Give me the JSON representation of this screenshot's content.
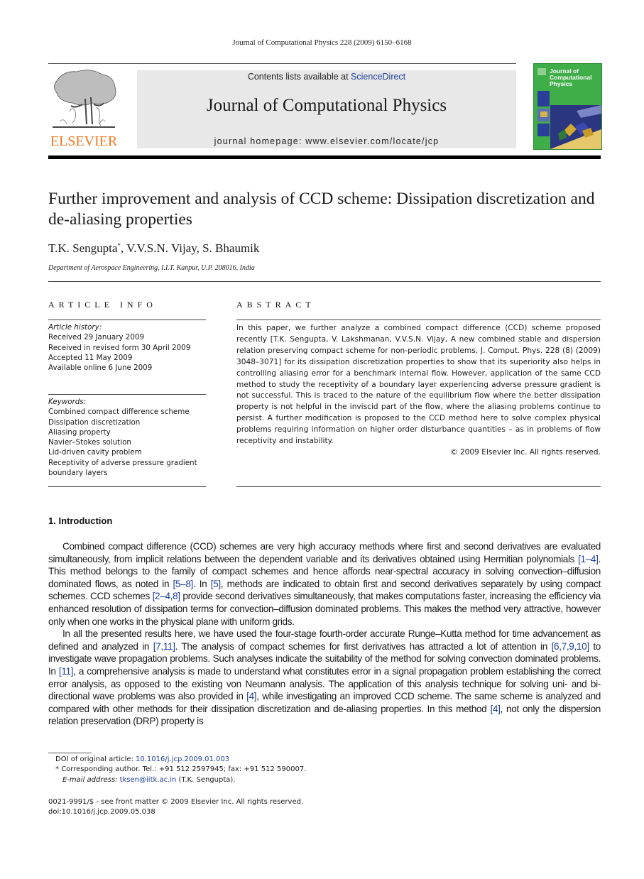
{
  "header": {
    "running_head": "Journal of Computational Physics 228 (2009) 6150–6168",
    "contents_prefix": "Contents lists available at ",
    "contents_link": "ScienceDirect",
    "journal_title": "Journal of Computational Physics",
    "homepage": "journal homepage: www.elsevier.com/locate/jcp",
    "publisher_logo_text": "ELSEVIER",
    "cover_title": [
      "Journal of",
      "Computational",
      "Physics"
    ],
    "colors": {
      "publisher_orange": "#f07a1e",
      "link_blue": "#1f3f9a",
      "cover_green": "#3fae49",
      "banner_gray": "#e8e8e8"
    }
  },
  "article": {
    "title": "Further improvement and analysis of CCD scheme: Dissipation discretization and de-aliasing properties",
    "authors": [
      {
        "name": "T.K. Sengupta",
        "mark": "*"
      },
      {
        "name": ", V.V.S.N. Vijay, S. Bhaumik",
        "mark": ""
      }
    ],
    "affiliation": "Department of Aerospace Engineering, I.I.T. Kanpur, U.P. 208016, India"
  },
  "article_info": {
    "heading": "ARTICLE INFO",
    "history_label": "Article history:",
    "history": [
      "Received 29 January 2009",
      "Received in revised form 30 April 2009",
      "Accepted 11 May 2009",
      "Available online 6 June 2009"
    ],
    "keywords_label": "Keywords:",
    "keywords": [
      "Combined compact difference scheme",
      "Dissipation discretization",
      "Aliasing property",
      "Navier–Stokes solution",
      "Lid-driven cavity problem",
      "Receptivity of adverse pressure gradient",
      "boundary layers"
    ]
  },
  "abstract": {
    "heading": "ABSTRACT",
    "text": "In this paper, we further analyze a combined compact difference (CCD) scheme proposed recently [T.K. Sengupta, V. Lakshmanan, V.V.S.N. Vijay, A new combined stable and dispersion relation preserving compact scheme for non-periodic problems, J. Comput. Phys. 228 (8) (2009) 3048–3071] for its dissipation discretization properties to show that its superiority also helps in controlling aliasing error for a benchmark internal flow. However, application of the same CCD method to study the receptivity of a boundary layer experiencing adverse pressure gradient is not successful. This is traced to the nature of the equilibrium flow where the better dissipation property is not helpful in the inviscid part of the flow, where the aliasing problems continue to persist. A further modification is proposed to the CCD method here to solve complex physical problems requiring information on higher order disturbance quantities – as in problems of flow receptivity and instability.",
    "copyright": "© 2009 Elsevier Inc. All rights reserved."
  },
  "introduction": {
    "heading": "1. Introduction",
    "paragraphs": [
      [
        {
          "t": "Combined compact difference (CCD) schemes are very high accuracy methods where first and second derivatives are evaluated simultaneously, from implicit relations between the dependent variable and its derivatives obtained using Hermitian polynomials "
        },
        {
          "c": "[1–4]"
        },
        {
          "t": ". This method belongs to the family of compact schemes and hence affords near-spectral accuracy in solving convection–diffusion dominated flows, as noted in "
        },
        {
          "c": "[5–8]"
        },
        {
          "t": ". In "
        },
        {
          "c": "[5]"
        },
        {
          "t": ", methods are indicated to obtain first and second derivatives separately by using compact schemes. CCD schemes "
        },
        {
          "c": "[2–4,8]"
        },
        {
          "t": " provide second derivatives simultaneously, that makes computations faster, increasing the efficiency via enhanced resolution of dissipation terms for convection–diffusion dominated problems. This makes the method very attractive, however only when one works in the physical plane with uniform grids."
        }
      ],
      [
        {
          "t": "In all the presented results here, we have used the four-stage fourth-order accurate Runge–Kutta method for time advancement as defined and analyzed in "
        },
        {
          "c": "[7,11]"
        },
        {
          "t": ". The analysis of compact schemes for first derivatives has attracted a lot of attention in "
        },
        {
          "c": "[6,7,9,10]"
        },
        {
          "t": " to investigate wave propagation problems. Such analyses indicate the suitability of the method for solving convection dominated problems. In "
        },
        {
          "c": "[11]"
        },
        {
          "t": ", a comprehensive analysis is made to understand what constitutes error in a signal propagation problem establishing the correct error analysis, as opposed to the existing von Neumann analysis. The application of this analysis technique for solving uni- and bi-directional wave problems was also provided in "
        },
        {
          "c": "[4]"
        },
        {
          "t": ", while investigating an improved CCD scheme. The same scheme is analyzed and compared with other methods for their dissipation discretization and de-aliasing properties. In this method "
        },
        {
          "c": "[4]"
        },
        {
          "t": ", not only the dispersion relation preservation (DRP) property is"
        }
      ]
    ]
  },
  "footnotes": {
    "doi_label": "DOI of original article: ",
    "doi_link": "10.1016/j.jcp.2009.01.003",
    "corresponding_mark": "*",
    "corresponding": "Corresponding author. Tel.: +91 512 2597945; fax: +91 512 590007.",
    "email_label": "E-mail address: ",
    "email": "tksen@iitk.ac.in",
    "email_owner": " (T.K. Sengupta)."
  },
  "front_matter": {
    "issn_line": "0021-9991/$ - see front matter © 2009 Elsevier Inc. All rights reserved.",
    "doi_line": "doi:10.1016/j.jcp.2009.05.038"
  }
}
